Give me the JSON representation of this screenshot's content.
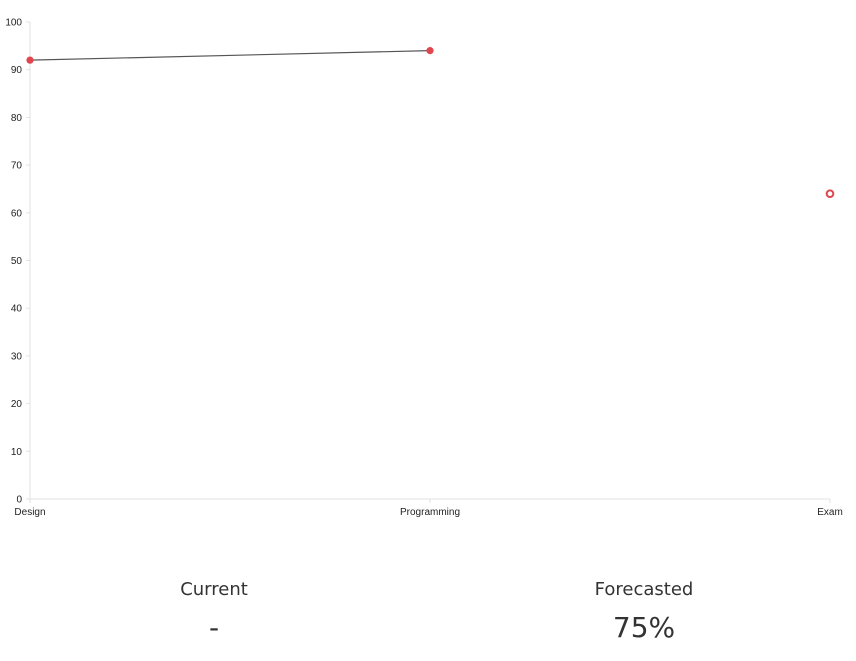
{
  "chart_data": {
    "type": "line",
    "categories": [
      "Design",
      "Programming",
      "Exam"
    ],
    "series": [
      {
        "values": [
          92,
          94,
          null
        ],
        "marker": "filled",
        "color": "#e0464e",
        "line_color": "#555555"
      },
      {
        "values": [
          null,
          null,
          64
        ],
        "marker": "hollow",
        "color": "#e0464e"
      }
    ],
    "title": "",
    "xlabel": "",
    "ylabel": "",
    "ylim": [
      0,
      100
    ],
    "yticks": [
      0,
      10,
      20,
      30,
      40,
      50,
      60,
      70,
      80,
      90,
      100
    ],
    "grid": false,
    "legend": "none"
  },
  "stats": {
    "current": {
      "label": "Current",
      "value": "-"
    },
    "forecasted": {
      "label": "Forecasted",
      "value": "75%"
    }
  }
}
